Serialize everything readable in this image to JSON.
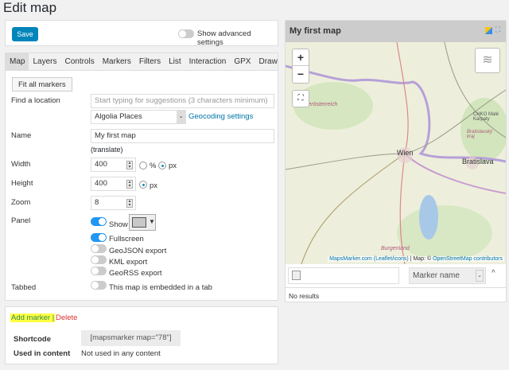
{
  "page_title": "Edit map",
  "top": {
    "save_label": "Save",
    "advanced_label": "Show advanced settings",
    "advanced_on": false
  },
  "tabs": [
    "Map",
    "Layers",
    "Controls",
    "Markers",
    "Filters",
    "List",
    "Interaction",
    "GPX",
    "Draw"
  ],
  "active_tab": "Map",
  "form": {
    "fit_all_label": "Fit all markers",
    "find_label": "Find a location",
    "find_placeholder": "Start typing for suggestions (3 characters minimum)",
    "geocoder": "Algolia Places",
    "geocoding_link": "Geocoding settings",
    "name_label": "Name",
    "name_value": "My first map",
    "translate": "(translate)",
    "width_label": "Width",
    "width_value": "400",
    "unit_pct": "%",
    "unit_px": "px",
    "width_unit": "px",
    "height_label": "Height",
    "height_value": "400",
    "height_unit": "px",
    "zoom_label": "Zoom",
    "zoom_value": "8",
    "panel_label": "Panel",
    "panel_show": "Show",
    "panel_show_on": true,
    "panel_color": "#c8c8c8",
    "fullscreen": "Fullscreen",
    "fullscreen_on": true,
    "geojson": "GeoJSON export",
    "geojson_on": false,
    "kml": "KML export",
    "kml_on": false,
    "georss": "GeoRSS export",
    "georss_on": false,
    "tabbed_label": "Tabbed",
    "tabbed_text": "This map is embedded in a tab",
    "tabbed_on": false
  },
  "bottom": {
    "add_marker": "Add marker",
    "sep": "|",
    "delete": "Delete",
    "shortcode_label": "Shortcode",
    "shortcode": "[mapsmarker map=\"78\"]",
    "used_label": "Used in content",
    "used_value": "Not used in any content"
  },
  "map": {
    "title": "My first map",
    "zoom_in": "+",
    "zoom_out": "−",
    "places": [
      "Niederösterreich",
      "Wien",
      "Bratislava",
      "CHKO Malé Karpaty",
      "Bratislavský kraj",
      "Burgenland"
    ],
    "attribution_link1": "MapsMarker.com (Leaflet/icons)",
    "attribution_mid": " | Map: © ",
    "attribution_link2": "OpenStreetMap contributors",
    "sort_value": "Marker name",
    "no_results": "No results"
  }
}
